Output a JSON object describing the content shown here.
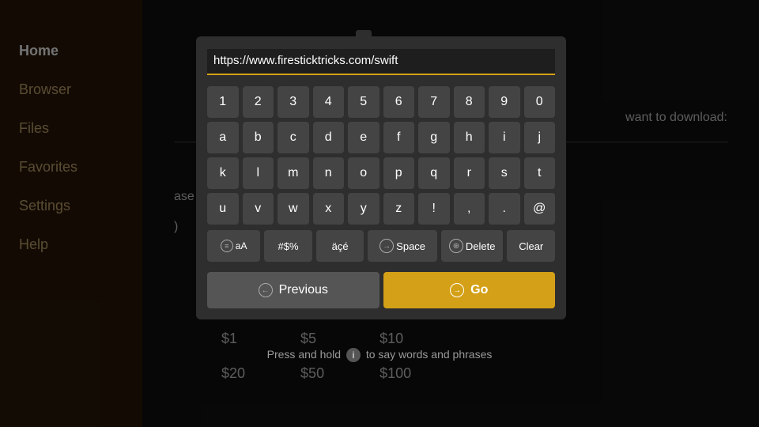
{
  "sidebar": {
    "items": [
      {
        "label": "Home",
        "active": true
      },
      {
        "label": "Browser",
        "active": false
      },
      {
        "label": "Files",
        "active": false
      },
      {
        "label": "Favorites",
        "active": false
      },
      {
        "label": "Settings",
        "active": false
      },
      {
        "label": "Help",
        "active": false
      }
    ]
  },
  "main": {
    "download_text": "want to download:",
    "donation_text": "ase donation buttons:",
    "donations_row1": [
      "$1",
      "$5",
      "$10"
    ],
    "donations_row2": [
      "$20",
      "$50",
      "$100"
    ]
  },
  "keyboard_dialog": {
    "url_value": "https://www.firesticktricks.com/swift",
    "url_placeholder": "https://www.firesticktricks.com/swift",
    "numbers": [
      "1",
      "2",
      "3",
      "4",
      "5",
      "6",
      "7",
      "8",
      "9",
      "0"
    ],
    "row1": [
      "a",
      "b",
      "c",
      "d",
      "e",
      "f",
      "g",
      "h",
      "i",
      "j"
    ],
    "row2": [
      "k",
      "l",
      "m",
      "n",
      "o",
      "p",
      "q",
      "r",
      "s",
      "t"
    ],
    "row3": [
      "u",
      "v",
      "w",
      "x",
      "y",
      "z",
      "!",
      ",",
      ".",
      "@"
    ],
    "special": {
      "aa_label": "aA",
      "hash_label": "#$%",
      "accent_label": "äçé",
      "space_label": "Space",
      "delete_label": "Delete",
      "clear_label": "Clear"
    },
    "actions": {
      "previous_label": "Previous",
      "go_label": "Go"
    }
  },
  "hint": {
    "text": "Press and hold",
    "icon_label": "i",
    "text2": "to say words and phrases"
  },
  "colors": {
    "sidebar_bg": "#2a1a08",
    "active_text": "#ffffff",
    "inactive_text": "#c8a870",
    "key_bg": "#444444",
    "dialog_bg": "#2e2e2e",
    "go_bg": "#d4a017"
  }
}
